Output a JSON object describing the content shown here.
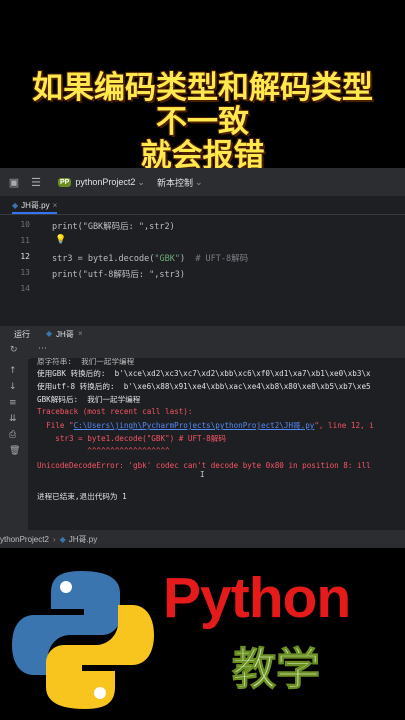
{
  "headline": {
    "line1": "如果编码类型和解码类型",
    "line2": "不一致",
    "line3": "就会报错"
  },
  "ide": {
    "project_badge": "PP",
    "project_name": "pythonProject2",
    "vcs_label": "新本控制",
    "tab_file": "JH哥.py",
    "editor": {
      "line_numbers": [
        "10",
        "11",
        "12",
        "13",
        "14"
      ],
      "line10": "print(\"GBK解码后: \",str2)",
      "line12_a": "str3 = byte1.decode(",
      "line12_str": "\"GBK\"",
      "line12_b": ")",
      "line12_comment": "  # UFT-8解码",
      "line13": "print(\"utf-8解码后: \",str3)"
    },
    "run": {
      "label": "运行",
      "tab": "JH哥",
      "console": [
        "原字符串:  我们一起学编程",
        "使用GBK 转换后的:  b'\\xce\\xd2\\xc3\\xc7\\xd2\\xbb\\xc6\\xf0\\xd1\\xa7\\xb1\\xe0\\xb3\\x",
        "使用utf-8 转换后的:  b'\\xe6\\x88\\x91\\xe4\\xbb\\xac\\xe4\\xb8\\x80\\xe8\\xb5\\xb7\\xe5",
        "GBK解码后:  我们一起学编程",
        "Traceback (most recent call last):",
        "  File \"",
        "C:\\Users\\jingh\\PycharmProjects\\pythonProject2\\JH哥.py",
        "\", line 12, i",
        "    str3 = byte1.decode(\"GBK\") # UFT-8解码",
        "           ^^^^^^^^^^^^^^^^^^",
        "UnicodeDecodeError: 'gbk' codec can't decode byte 0x80 in position 8: ill",
        "进程已结束,退出代码为 1"
      ]
    },
    "status": {
      "project": "ythonProject2",
      "file": "JH哥.py"
    }
  },
  "branding": {
    "title": "Python",
    "subtitle": "教学",
    "colors": {
      "python_red": "#e51a1a",
      "logo_blue": "#3a75b0",
      "logo_yellow": "#f7c51e"
    }
  }
}
